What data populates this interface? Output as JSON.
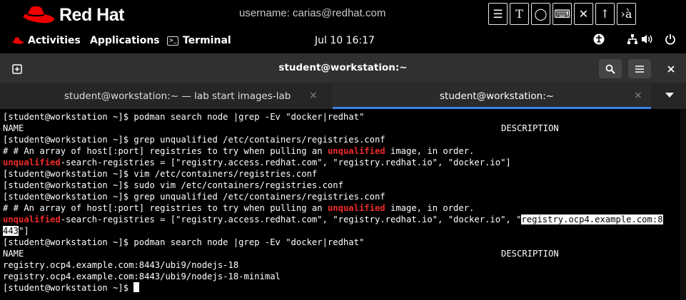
{
  "brand": {
    "logo_text": "Red Hat",
    "username": "username: carias@redhat.com"
  },
  "top_icons": [
    {
      "name": "notes-icon",
      "glyph": "☰"
    },
    {
      "name": "text-tool-icon",
      "glyph": "T"
    },
    {
      "name": "circle-tool-icon",
      "glyph": "◯"
    },
    {
      "name": "keyboard-icon",
      "glyph": "⌨"
    },
    {
      "name": "no-mic-icon",
      "glyph": "✕"
    },
    {
      "name": "upload-icon",
      "glyph": "↑"
    },
    {
      "name": "ime-icon",
      "glyph": "›à"
    }
  ],
  "panel": {
    "activities": "Activities",
    "applications": "Applications",
    "terminal": "Terminal",
    "clock": "Jul 10  16:17"
  },
  "window": {
    "title": "student@workstation:~"
  },
  "tabs": [
    {
      "label": "student@workstation:~ — lab start images-lab",
      "active": false
    },
    {
      "label": "student@workstation:~",
      "active": true
    }
  ],
  "terminal": {
    "lines": [
      [
        {
          "t": "[student@workstation ~]$ podman search node |grep -Ev \"docker|redhat\""
        }
      ],
      [
        {
          "t": "NAME"
        }
      ],
      [
        {
          "t": "[student@workstation ~]$ grep unqualified /etc/containers/registries.conf"
        }
      ],
      [
        {
          "t": "# # An array of host[:port] registries to try when pulling an "
        },
        {
          "t": "unqualified",
          "c": "hl"
        },
        {
          "t": " image, in order."
        }
      ],
      [
        {
          "t": "unqualified",
          "c": "hl"
        },
        {
          "t": "-search-registries = [\"registry.access.redhat.com\", \"registry.redhat.io\", \"docker.io\"]"
        }
      ],
      [
        {
          "t": "[student@workstation ~]$ vim /etc/containers/registries.conf"
        }
      ],
      [
        {
          "t": "[student@workstation ~]$ sudo vim /etc/containers/registries.conf"
        }
      ],
      [
        {
          "t": "[student@workstation ~]$ grep unqualified /etc/containers/registries.conf"
        }
      ],
      [
        {
          "t": "# # An array of host[:port] registries to try when pulling an "
        },
        {
          "t": "unqualified",
          "c": "hl"
        },
        {
          "t": " image, in order."
        }
      ],
      [
        {
          "t": "unqualified",
          "c": "hl"
        },
        {
          "t": "-search-registries = [\"registry.access.redhat.com\", \"registry.redhat.io\", \"docker.io\", \""
        },
        {
          "t": "registry.ocp4.example.com:8",
          "c": "sel"
        }
      ],
      [
        {
          "t": "443",
          "c": "sel"
        },
        {
          "t": "\"]"
        }
      ],
      [
        {
          "t": "[student@workstation ~]$ podman search node |grep -Ev \"docker|redhat\""
        }
      ],
      [
        {
          "t": "NAME"
        }
      ],
      [
        {
          "t": "registry.ocp4.example.com:8443/ubi9/nodejs-18"
        }
      ],
      [
        {
          "t": "registry.ocp4.example.com:8443/ubi9/nodejs-18-minimal"
        }
      ],
      [
        {
          "t": "[student@workstation ~]$ "
        }
      ]
    ],
    "desc_label": "DESCRIPTION",
    "desc_rows": [
      1,
      12
    ],
    "cursor_row": 15
  }
}
